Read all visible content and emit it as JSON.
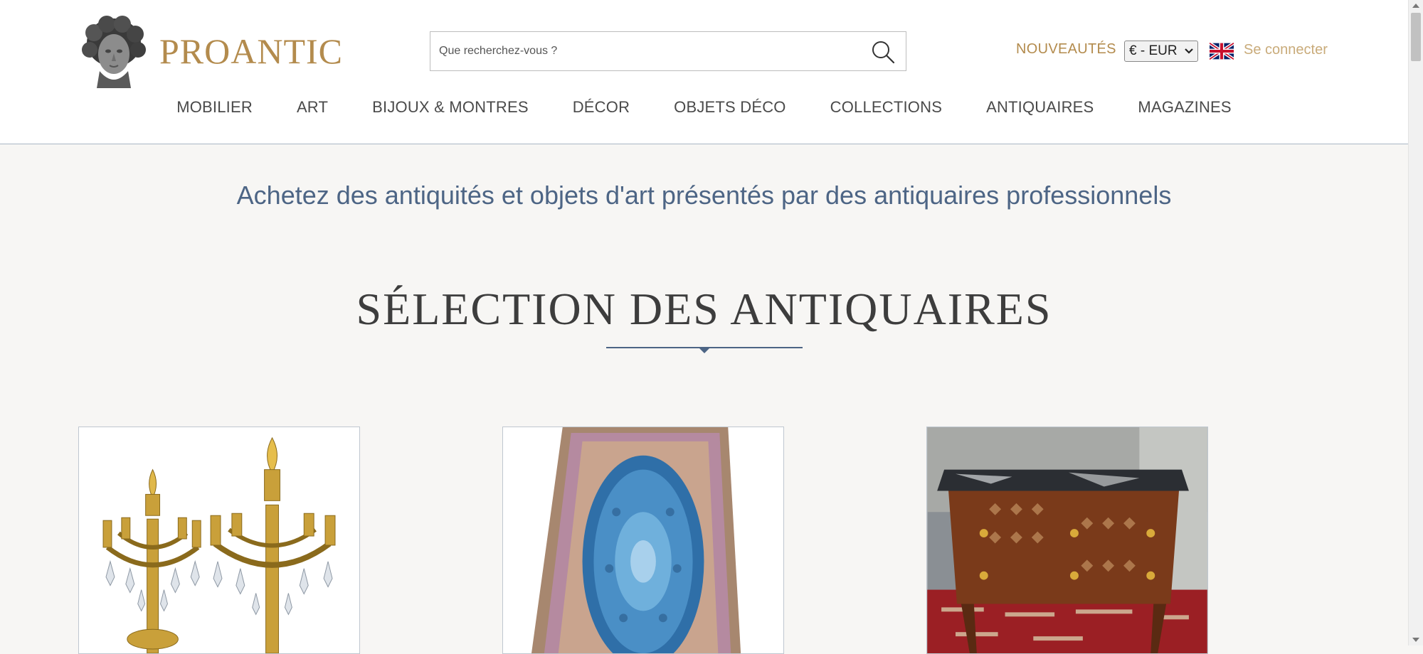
{
  "brand": {
    "name": "PROANTIC"
  },
  "search": {
    "placeholder": "Que recherchez-vous ?"
  },
  "header": {
    "nouveautes": "NOUVEAUTÉS",
    "currency": "€ - EUR",
    "login": "Se connecter"
  },
  "nav": {
    "items": [
      "MOBILIER",
      "ART",
      "BIJOUX & MONTRES",
      "DÉCOR",
      "OBJETS DÉCO",
      "COLLECTIONS",
      "ANTIQUAIRES",
      "MAGAZINES"
    ]
  },
  "main": {
    "tagline": "Achetez des antiquités et objets d'art présentés par des antiquaires professionnels",
    "section_title": "SÉLECTION DES ANTIQUAIRES"
  },
  "colors": {
    "brand_gold": "#b38b4d",
    "accent_blue": "#4d6585",
    "background": "#f7f6f4"
  }
}
